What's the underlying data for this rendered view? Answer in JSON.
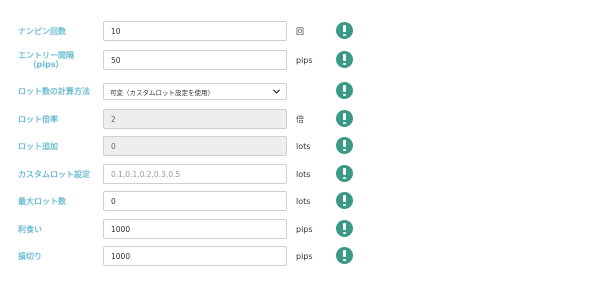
{
  "rows": [
    {
      "label": "ナンピン回数",
      "value": "10",
      "unit": "回"
    },
    {
      "label_line1": "エントリー間隔",
      "label_line2": "（pips）",
      "value": "50",
      "unit": "pips"
    },
    {
      "label": "ロット数の計算方法",
      "selected": "可変（カスタムロット設定を使用）",
      "unit": ""
    },
    {
      "label": "ロット倍率",
      "value": "2",
      "unit": "倍"
    },
    {
      "label": "ロット追加",
      "value": "0",
      "unit": "lots"
    },
    {
      "label": "カスタムロット設定",
      "placeholder": "0.1,0.1,0.2,0.3,0.5",
      "unit": "lots"
    },
    {
      "label": "最大ロット数",
      "value": "0",
      "unit": "lots"
    },
    {
      "label": "利食い",
      "value": "1000",
      "unit": "pips"
    },
    {
      "label": "損切り",
      "value": "1000",
      "unit": "pips"
    }
  ],
  "colors": {
    "label": "#6bbcd2",
    "icon": "#3a9a86",
    "disabled_bg": "#eeeeee"
  },
  "icon_name": "exclamation-circle-icon"
}
